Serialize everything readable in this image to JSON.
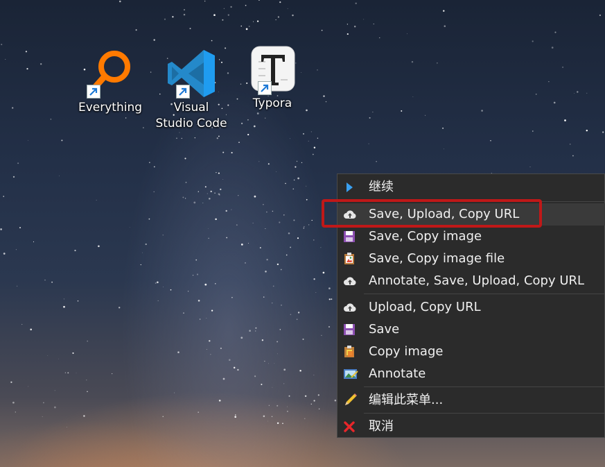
{
  "desktop": {
    "icons": [
      {
        "label": "Everything"
      },
      {
        "label": "Visual Studio Code"
      },
      {
        "label": "Typora"
      }
    ]
  },
  "context_menu": {
    "items": [
      {
        "label": "继续",
        "icon": "play-arrow-icon"
      },
      {
        "label": "Save, Upload, Copy URL",
        "icon": "cloud-upload-icon"
      },
      {
        "label": "Save, Copy image",
        "icon": "floppy-disk-icon"
      },
      {
        "label": "Save, Copy image file",
        "icon": "clipboard-image-icon"
      },
      {
        "label": "Annotate, Save, Upload, Copy URL",
        "icon": "cloud-upload-icon"
      },
      {
        "label": "Upload, Copy URL",
        "icon": "cloud-upload-icon"
      },
      {
        "label": "Save",
        "icon": "floppy-disk-icon"
      },
      {
        "label": "Copy image",
        "icon": "clipboard-copy-icon"
      },
      {
        "label": "Annotate",
        "icon": "image-annotate-icon"
      },
      {
        "label": "编辑此菜单...",
        "icon": "pencil-icon"
      },
      {
        "label": "取消",
        "icon": "red-x-icon"
      }
    ]
  },
  "colors": {
    "menu_bg": "#2b2b2b",
    "highlight_border": "#c01818",
    "vscode_blue": "#2489ca",
    "everything_orange": "#ff7a00"
  }
}
